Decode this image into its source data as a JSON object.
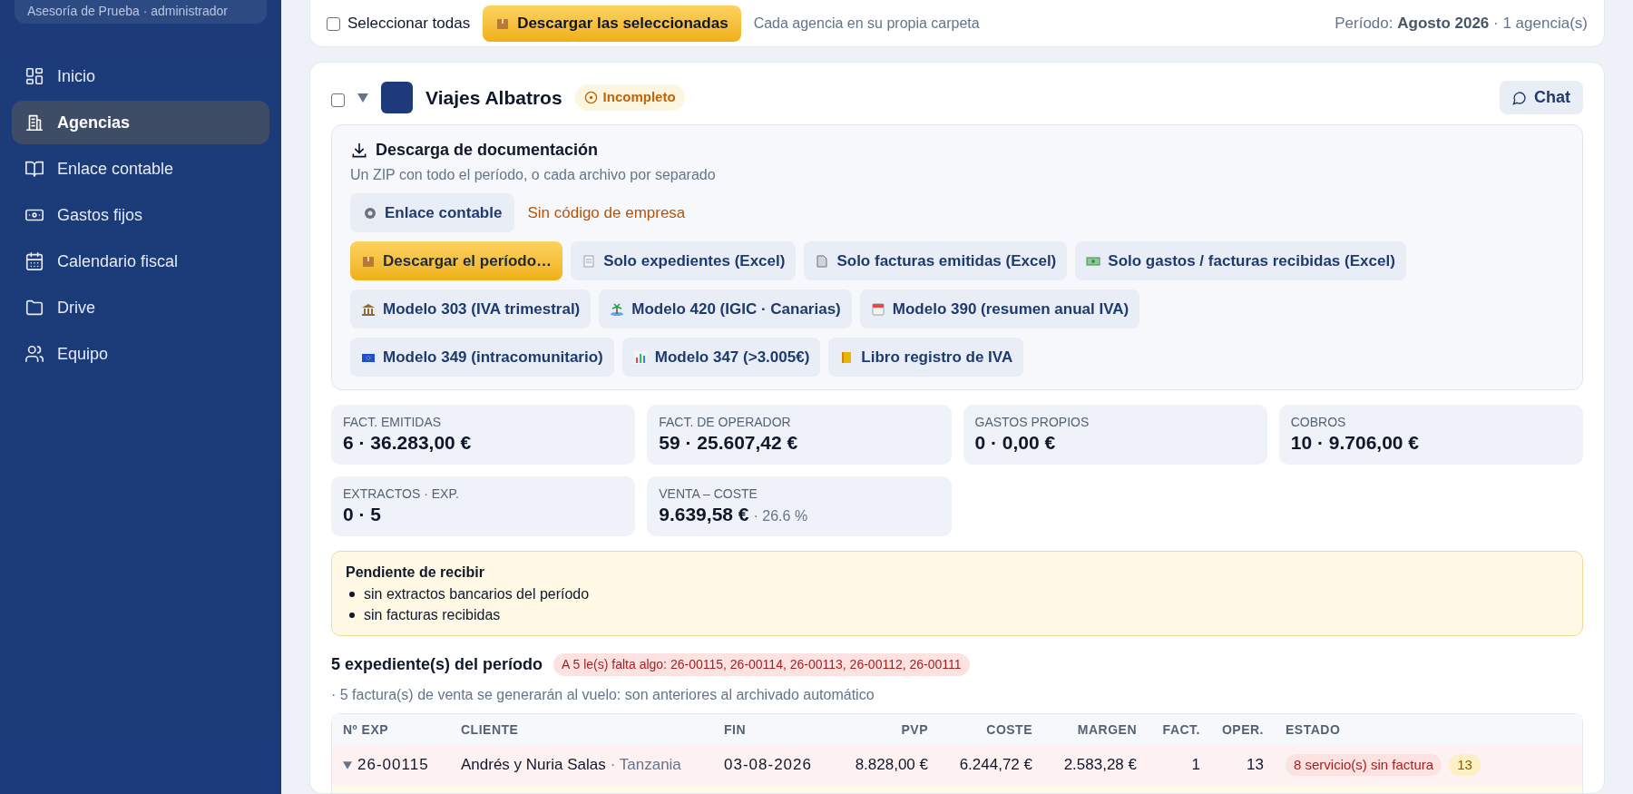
{
  "sidebar": {
    "account": "Asesoría de Prueba · administrador",
    "items": [
      {
        "label": "Inicio",
        "selected": false
      },
      {
        "label": "Agencias",
        "selected": true
      },
      {
        "label": "Enlace contable",
        "selected": false
      },
      {
        "label": "Gastos fijos",
        "selected": false
      },
      {
        "label": "Calendario fiscal",
        "selected": false
      },
      {
        "label": "Drive",
        "selected": false
      },
      {
        "label": "Equipo",
        "selected": false
      }
    ]
  },
  "toolbar": {
    "select_all": {
      "label": "Seleccionar todas",
      "checked": false
    },
    "download_button": "Descargar las seleccionadas",
    "hint": "Cada agencia en su propia carpeta",
    "period": "Período: **Agosto 2026** · 1 agencia(s)"
  },
  "agency": {
    "checked": false,
    "expanded": true,
    "name": "Viajes Albatros",
    "status": "Incompleto",
    "chat_button": "Chat",
    "downloads": {
      "title": "Descarga de documentación",
      "subtitle": "Un ZIP con todo el período, o cada archivo por separado",
      "link_button": "Enlace contable",
      "link_warning": "Sin código de empresa",
      "rows": [
        [
          {
            "label": "Descargar el período…",
            "kind": "primary"
          },
          {
            "label": "Solo expedientes (Excel)",
            "kind": "secondary"
          },
          {
            "label": "Solo facturas emitidas (Excel)",
            "kind": "secondary"
          },
          {
            "label": "Solo gastos / facturas recibidas (Excel)",
            "kind": "secondary"
          }
        ],
        [
          {
            "label": "Modelo 303 (IVA trimestral)",
            "kind": "secondary"
          },
          {
            "label": "Modelo 420 (IGIC · Canarias)",
            "kind": "secondary"
          },
          {
            "label": "Modelo 390 (resumen anual IVA)",
            "kind": "secondary"
          }
        ],
        [
          {
            "label": "Modelo 349 (intracomunitario)",
            "kind": "secondary"
          },
          {
            "label": "Modelo 347 (>3.005€)",
            "kind": "secondary"
          },
          {
            "label": "Libro registro de IVA",
            "kind": "secondary"
          }
        ]
      ]
    },
    "stats": [
      {
        "label": "FACT. EMITIDAS",
        "value": "6 · 36.283,00 €"
      },
      {
        "label": "FACT. DE OPERADOR",
        "value": "59 · 25.607,42 €"
      },
      {
        "label": "GASTOS PROPIOS",
        "value": "0 · 0,00 €"
      },
      {
        "label": "COBROS",
        "value": "10 · 9.706,00 €"
      },
      {
        "label": "EXTRACTOS · EXP.",
        "value": "0 · 5"
      },
      {
        "label": "VENTA – COSTE",
        "value": "9.639,58 €",
        "note": "· 26.6 %"
      }
    ],
    "pending": {
      "title": "Pendiente de recibir",
      "items": [
        "sin extractos bancarios del período",
        "sin facturas recibidas"
      ]
    },
    "files": {
      "title": "5 expediente(s) del período",
      "alert": "A 5 le(s) falta algo: 26-00115, 26-00114, 26-00113, 26-00112, 26-00111",
      "note": "· 5 factura(s) de venta se generarán al vuelo: son anteriores al archivado automático",
      "table": {
        "columns": [
          "Nº EXP",
          "CLIENTE",
          "FIN",
          "PVP",
          "COSTE",
          "MARGEN",
          "FACT.",
          "OPER.",
          "ESTADO"
        ],
        "rows": [
          {
            "expanded": true,
            "number": "26-00115",
            "client": "Andrés y Nuria Salas",
            "destination": "· Tanzania",
            "end": "03-08-2026",
            "pvp": "8.828,00 €",
            "cost": "6.244,72 €",
            "margin": "2.583,28 €",
            "invoices": "1",
            "operators": "13",
            "badges": [
              {
                "text": "8 servicio(s) sin factura",
                "kind": "error"
              },
              {
                "text": "13",
                "kind": "warning"
              }
            ]
          }
        ]
      }
    }
  }
}
